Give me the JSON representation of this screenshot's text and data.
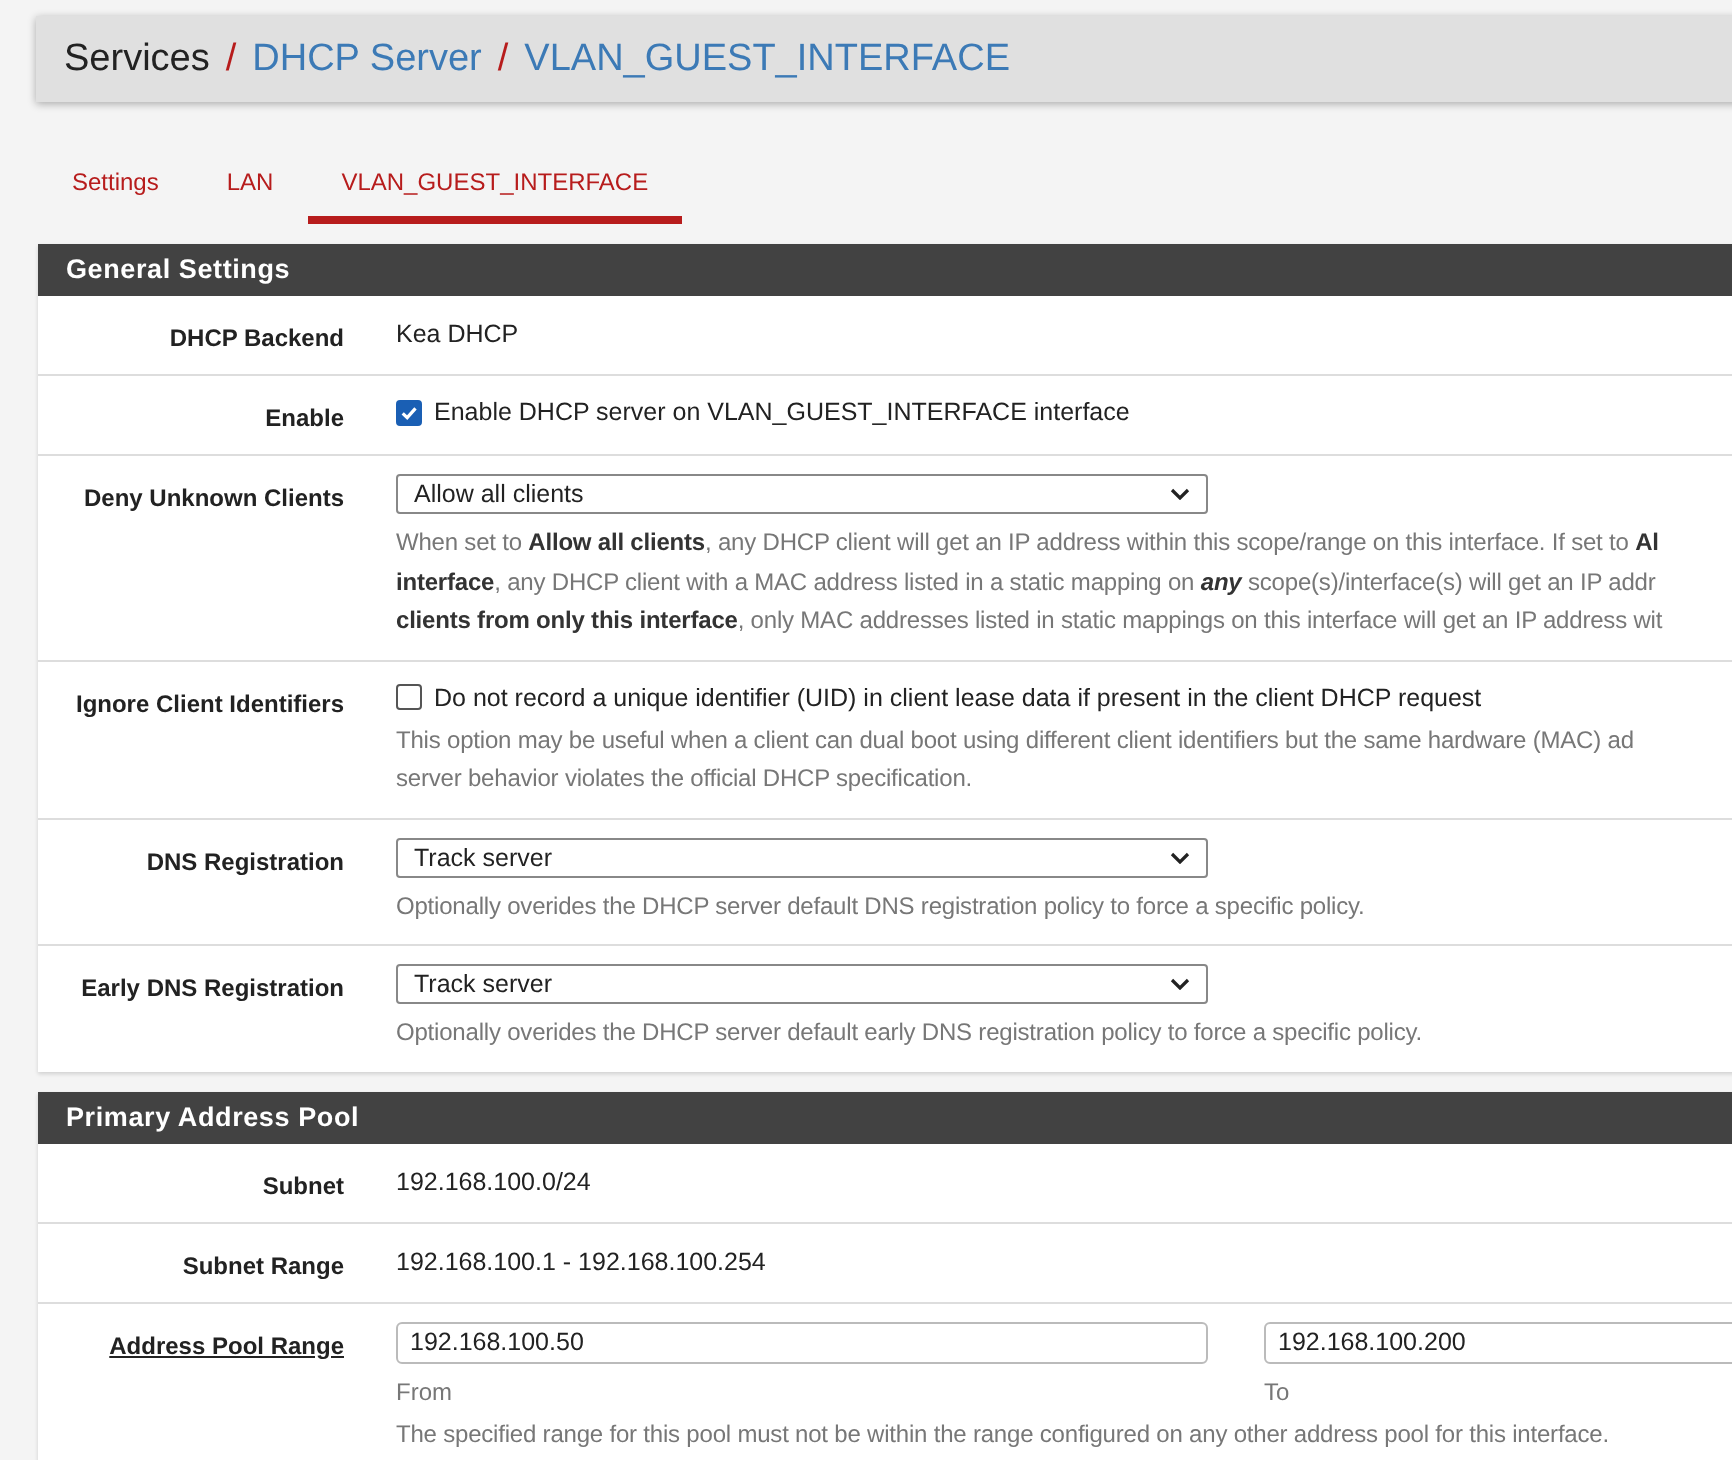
{
  "breadcrumb": [
    {
      "label": "Services",
      "link": false
    },
    {
      "label": "DHCP Server",
      "link": true
    },
    {
      "label": "VLAN_GUEST_INTERFACE",
      "link": true
    }
  ],
  "breadcrumb_separator": "/",
  "tabs": [
    {
      "label": "Settings",
      "selected": false
    },
    {
      "label": "LAN",
      "selected": false
    },
    {
      "label": "VLAN_GUEST_INTERFACE",
      "selected": true
    }
  ],
  "sections": [
    {
      "title": "General Settings",
      "rows": [
        {
          "kind": "text",
          "label": "DHCP Backend",
          "value": "Kea DHCP"
        },
        {
          "kind": "checkbox",
          "label": "Enable",
          "checked": true,
          "text": "Enable DHCP server on VLAN_GUEST_INTERFACE interface"
        },
        {
          "kind": "select",
          "label": "Deny Unknown Clients",
          "value": "Allow all clients",
          "help_lines": [
            "When set to **Allow all clients**, any DHCP client will get an IP address within this scope/range on this interface. If set to **Al**",
            "**interface**, any DHCP client with a MAC address listed in a static mapping on *any* scope(s)/interface(s) will get an IP addr",
            "**clients from only this interface**, only MAC addresses listed in static mappings on this interface will get an IP address wit"
          ]
        },
        {
          "kind": "checkbox",
          "label": "Ignore Client Identifiers",
          "checked": false,
          "text": "Do not record a unique identifier (UID) in client lease data if present in the client DHCP request",
          "help_lines": [
            "This option may be useful when a client can dual boot using different client identifiers but the same hardware (MAC) ad",
            "server behavior violates the official DHCP specification."
          ]
        },
        {
          "kind": "select",
          "label": "DNS Registration",
          "value": "Track server",
          "help_lines": [
            "Optionally overides the DHCP server default DNS registration policy to force a specific policy."
          ]
        },
        {
          "kind": "select",
          "label": "Early DNS Registration",
          "value": "Track server",
          "help_lines": [
            "Optionally overides the DHCP server default early DNS registration policy to force a specific policy."
          ]
        }
      ]
    },
    {
      "title": "Primary Address Pool",
      "rows": [
        {
          "kind": "text",
          "label": "Subnet",
          "value": "192.168.100.0/24"
        },
        {
          "kind": "text",
          "label": "Subnet Range",
          "value": "192.168.100.1 - 192.168.100.254"
        },
        {
          "kind": "range",
          "label": "Address Pool Range",
          "label_link": true,
          "from": "192.168.100.50",
          "from_caption": "From",
          "to": "192.168.100.200",
          "to_caption": "To",
          "help_lines": [
            "The specified range for this pool must not be within the range configured on any other address pool for this interface."
          ]
        }
      ]
    }
  ]
}
